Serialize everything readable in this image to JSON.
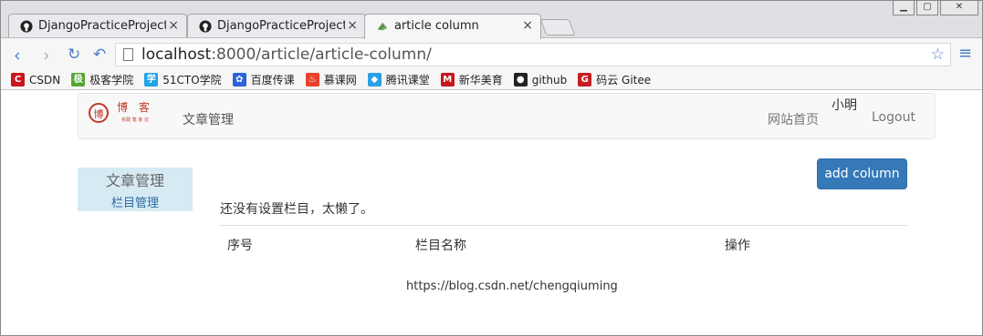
{
  "browser": {
    "tabs": [
      {
        "title": "DjangoPracticeProject/a",
        "icon": "github-icon"
      },
      {
        "title": "DjangoPracticeProject/fo",
        "icon": "github-icon"
      },
      {
        "title": "article column",
        "icon": "leaf-icon"
      }
    ],
    "close_symbol": "×",
    "url_host": "localhost",
    "url_rest": ":8000/article/article-column/",
    "bookmarks": [
      {
        "label": "CSDN",
        "color": "#c8161d",
        "glyph": "C"
      },
      {
        "label": "极客学院",
        "color": "#55a532",
        "glyph": "极"
      },
      {
        "label": "51CTO学院",
        "color": "#1fa2e8",
        "glyph": "学"
      },
      {
        "label": "百度传课",
        "color": "#2b63d9",
        "glyph": "✿"
      },
      {
        "label": "慕课网",
        "color": "#e8412c",
        "glyph": "♨"
      },
      {
        "label": "腾讯课堂",
        "color": "#29a0e6",
        "glyph": "◆"
      },
      {
        "label": "新华美育",
        "color": "#c8161d",
        "glyph": "M"
      },
      {
        "label": "github",
        "color": "#222222",
        "glyph": "●"
      },
      {
        "label": "码云 Gitee",
        "color": "#c71d23",
        "glyph": "G"
      }
    ]
  },
  "navbar": {
    "logo_text": "博  客",
    "logo_sub": "实践 笔 家 记",
    "left_link": "文章管理",
    "home_link": "网站首页",
    "user": "小明",
    "logout": "Logout"
  },
  "sidebar": {
    "heading": "文章管理",
    "item": "栏目管理"
  },
  "main": {
    "add_button": "add column",
    "empty_message": "还没有设置栏目，太懒了。",
    "columns": [
      "序号",
      "栏目名称",
      "操作"
    ]
  },
  "footer": {
    "text": "https://blog.csdn.net/chengqiuming"
  }
}
